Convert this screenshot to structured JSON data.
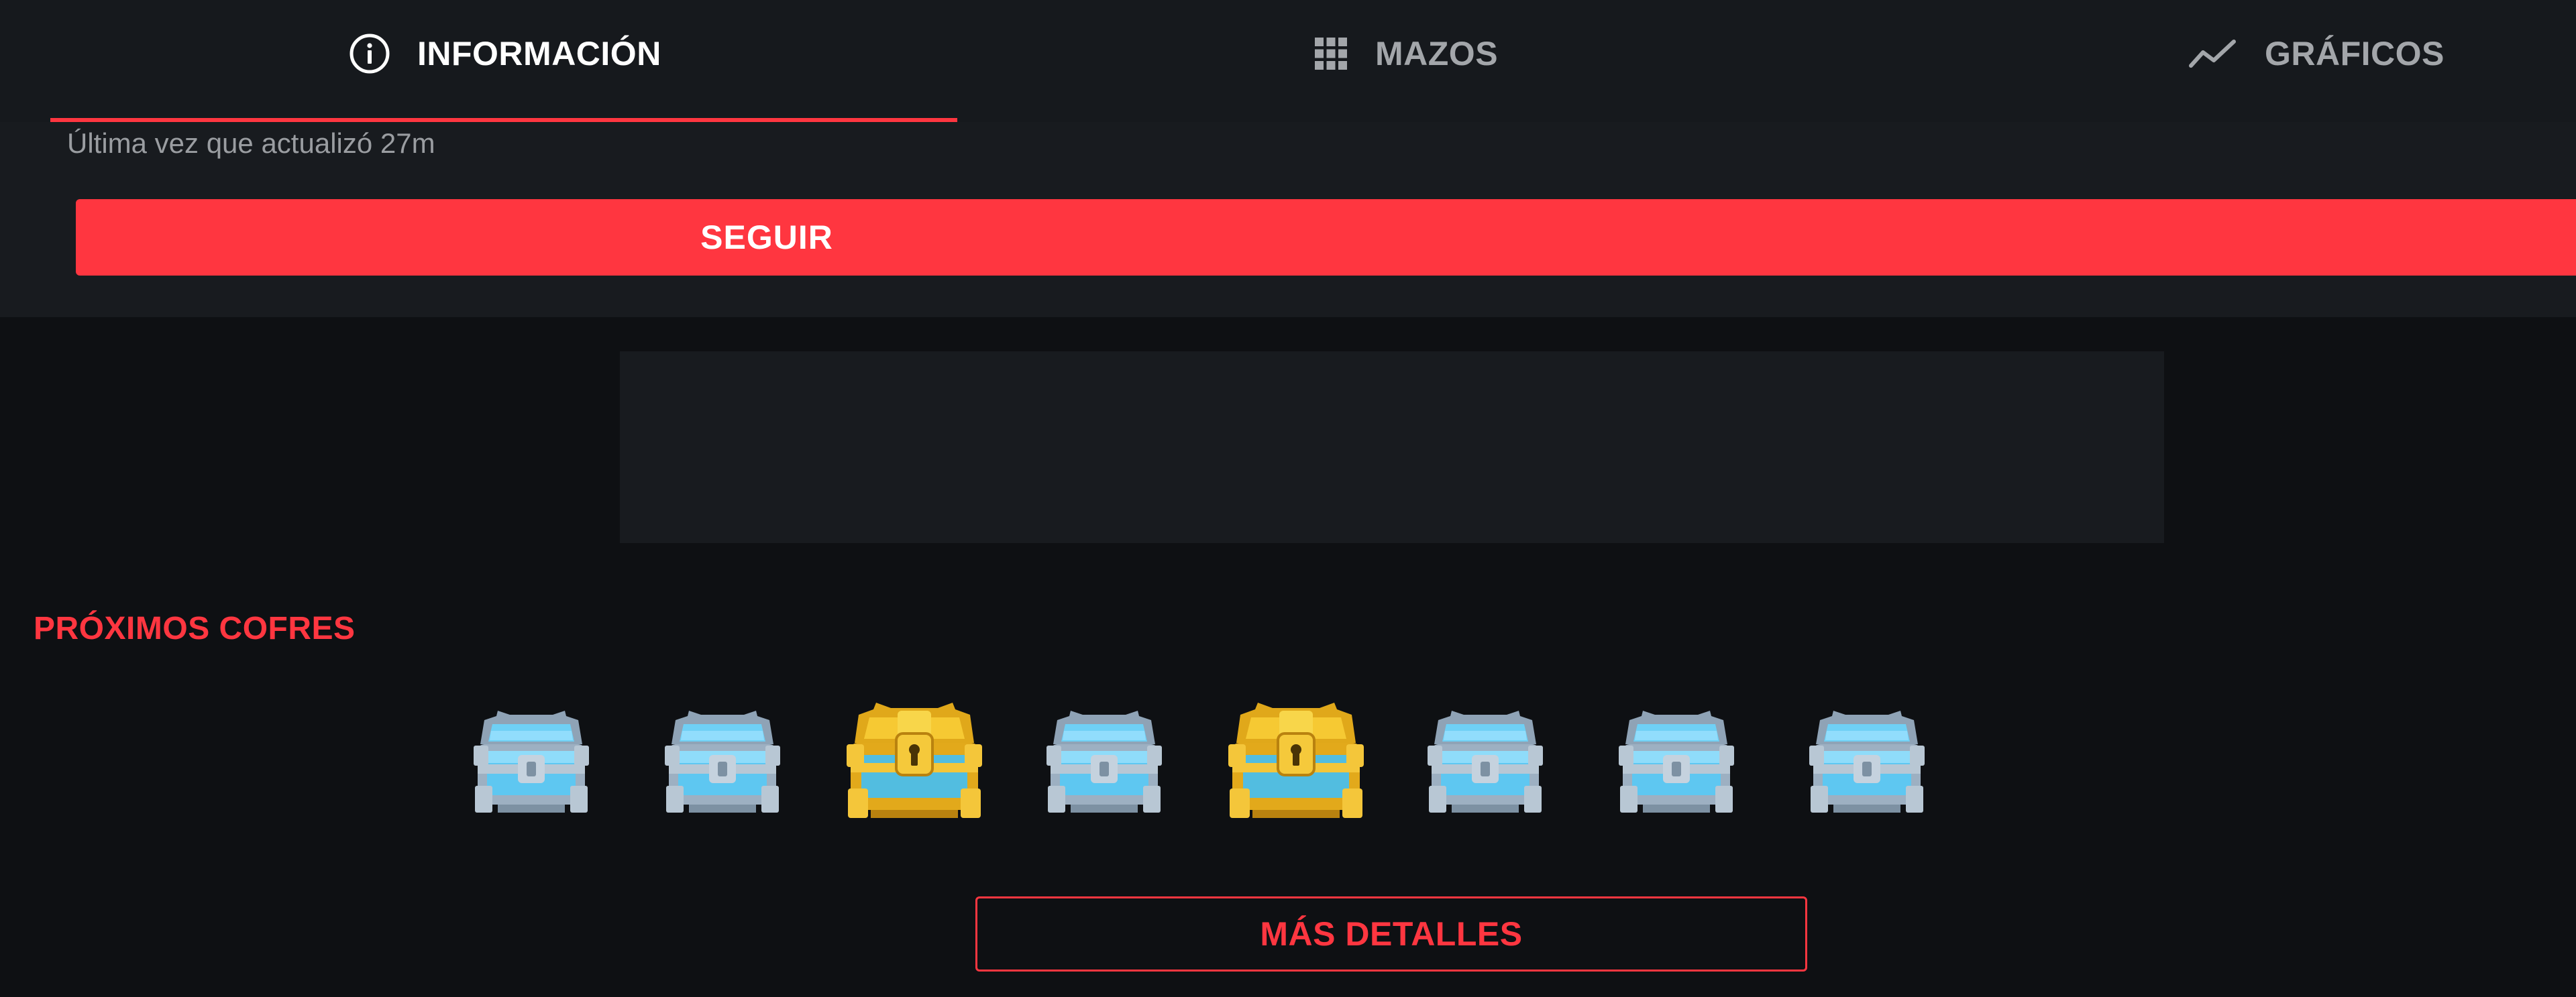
{
  "tabs": [
    {
      "label": "INFORMACIÓN",
      "icon": "info-icon",
      "active": true
    },
    {
      "label": "MAZOS",
      "icon": "grid-icon",
      "active": false
    },
    {
      "label": "GRÁFICOS",
      "icon": "line-chart-icon",
      "active": false
    }
  ],
  "header": {
    "last_update": "Última vez que actualizó 27m",
    "follow_label": "SEGUIR"
  },
  "chests_section": {
    "title": "PRÓXIMOS COFRES",
    "chests": [
      {
        "type": "silver",
        "icon": "silver-chest-icon"
      },
      {
        "type": "silver",
        "icon": "silver-chest-icon"
      },
      {
        "type": "golden",
        "icon": "golden-chest-icon"
      },
      {
        "type": "silver",
        "icon": "silver-chest-icon"
      },
      {
        "type": "golden",
        "icon": "golden-chest-icon"
      },
      {
        "type": "silver",
        "icon": "silver-chest-icon"
      },
      {
        "type": "silver",
        "icon": "silver-chest-icon"
      },
      {
        "type": "silver",
        "icon": "silver-chest-icon"
      }
    ],
    "details_label": "MÁS DETALLES"
  },
  "colors": {
    "accent": "#ff3640",
    "background": "#0e1013",
    "panel": "#181b1f",
    "tab_inactive": "#a3a6aa"
  }
}
